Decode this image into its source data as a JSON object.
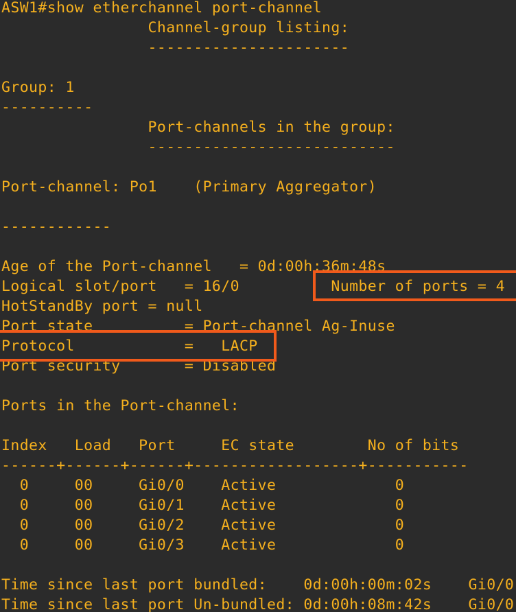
{
  "terminal": {
    "lines": [
      "ASW1#show etherchannel port-channel",
      "                Channel-group listing:",
      "                ----------------------",
      "",
      "Group: 1",
      "----------",
      "                Port-channels in the group:",
      "                ---------------------------",
      "",
      "Port-channel: Po1    (Primary Aggregator)",
      "",
      "------------",
      "",
      "Age of the Port-channel   = 0d:00h:36m:48s",
      "Logical slot/port   = 16/0          Number of ports = 4",
      "HotStandBy port = null",
      "Port state          = Port-channel Ag-Inuse",
      "Protocol            =   LACP",
      "Port security       = Disabled",
      "",
      "Ports in the Port-channel:",
      "",
      "Index   Load   Port     EC state        No of bits",
      "------+------+------+------------------+-----------",
      "  0     00     Gi0/0    Active             0",
      "  0     00     Gi0/1    Active             0",
      "  0     00     Gi0/2    Active             0",
      "  0     00     Gi0/3    Active             0",
      "",
      "Time since last port bundled:    0d:00h:00m:02s    Gi0/0",
      "Time since last port Un-bundled: 0d:00h:08m:42s    Gi0/0"
    ]
  },
  "colors": {
    "background": "#2b2b2b",
    "text": "#f5b01e",
    "highlight_box": "#f15a1b"
  }
}
